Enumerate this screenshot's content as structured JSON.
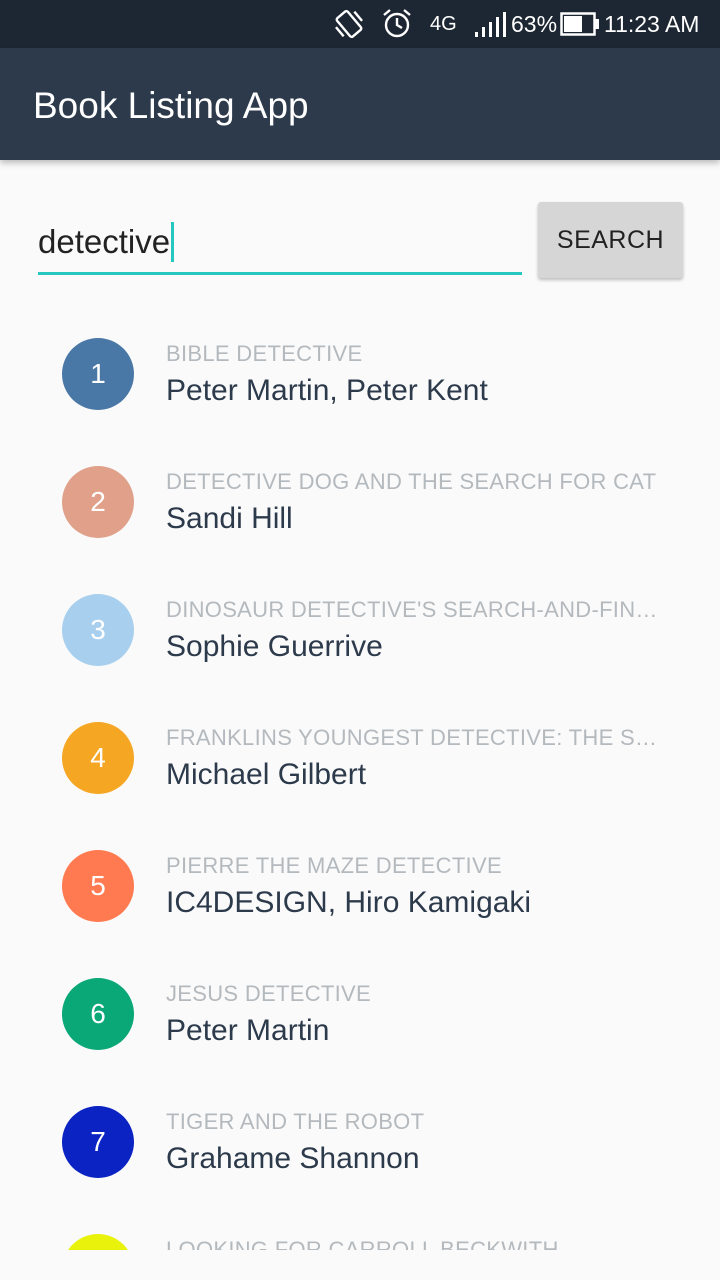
{
  "status_bar": {
    "network": "4G",
    "battery_percent": "63%",
    "time": "11:23 AM",
    "icons": [
      "vibrate-icon",
      "alarm-icon",
      "network-4g-icon",
      "signal-icon",
      "battery-icon"
    ]
  },
  "app_bar": {
    "title": "Book Listing App"
  },
  "search": {
    "value": "detective",
    "button_label": "SEARCH",
    "accent_color": "#26c6c1"
  },
  "books": [
    {
      "rank": "1",
      "title": "BIBLE DETECTIVE",
      "authors": "Peter Martin, Peter Kent",
      "color": "#4a78a6"
    },
    {
      "rank": "2",
      "title": "DETECTIVE DOG AND THE SEARCH FOR CAT",
      "authors": "Sandi Hill",
      "color": "#e0a08a"
    },
    {
      "rank": "3",
      "title": "DINOSAUR DETECTIVE'S SEARCH-AND-FIN…",
      "authors": "Sophie Guerrive",
      "color": "#a8d0ee"
    },
    {
      "rank": "4",
      "title": "FRANKLINS YOUNGEST DETECTIVE: THE S…",
      "authors": "Michael Gilbert",
      "color": "#f5a623"
    },
    {
      "rank": "5",
      "title": "PIERRE THE MAZE DETECTIVE",
      "authors": "IC4DESIGN, Hiro Kamigaki",
      "color": "#ff7a50"
    },
    {
      "rank": "6",
      "title": "JESUS DETECTIVE",
      "authors": "Peter Martin",
      "color": "#0aa777"
    },
    {
      "rank": "7",
      "title": "TIGER AND THE ROBOT",
      "authors": "Grahame Shannon",
      "color": "#0a23c2"
    },
    {
      "rank": "",
      "title": "LOOKING FOR CARROLL BECKWITH",
      "authors": "",
      "color": "#e8f20a"
    }
  ]
}
